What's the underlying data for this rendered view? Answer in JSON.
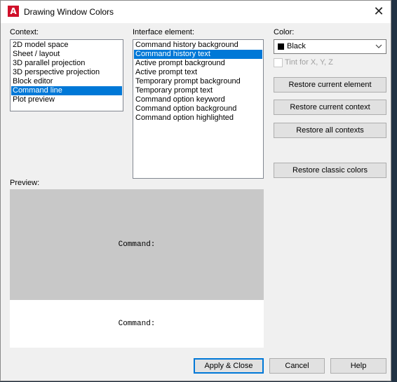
{
  "window": {
    "title": "Drawing Window Colors",
    "icon": "autocad-icon",
    "icon_glyph": "A",
    "close_glyph": "✕"
  },
  "context": {
    "label": "Context:",
    "items": [
      "2D model space",
      "Sheet / layout",
      "3D parallel projection",
      "3D perspective projection",
      "Block editor",
      "Command line",
      "Plot preview"
    ],
    "selected_index": 5
  },
  "interface_element": {
    "label": "Interface element:",
    "items": [
      "Command history background",
      "Command history text",
      "Active prompt background",
      "Active prompt text",
      "Temporary prompt background",
      "Temporary prompt text",
      "Command option keyword",
      "Command option background",
      "Command option highlighted"
    ],
    "selected_index": 1
  },
  "color": {
    "label": "Color:",
    "value": "Black",
    "swatch": "#000000",
    "tint_label": "Tint for X, Y, Z",
    "tint_checked": false
  },
  "buttons": {
    "restore_element": "Restore current element",
    "restore_context": "Restore current context",
    "restore_all": "Restore all contexts",
    "restore_classic": "Restore classic colors",
    "apply_close": "Apply & Close",
    "cancel": "Cancel",
    "help": "Help"
  },
  "preview": {
    "label": "Preview:",
    "history_text": "Command:",
    "prompt_text": "Command:",
    "history_bg": "#c8c8c8",
    "prompt_bg": "#ffffff"
  },
  "colors": {
    "selection": "#0078d7",
    "dialog_bg": "#f0f0f0"
  }
}
